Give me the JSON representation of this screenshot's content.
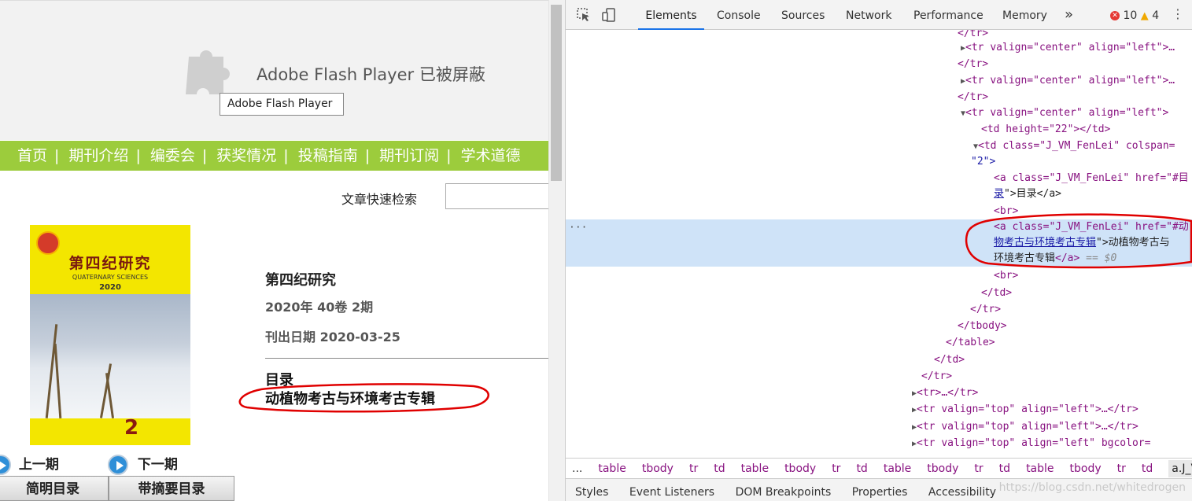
{
  "page": {
    "flash": {
      "message": "Adobe Flash Player 已被屏蔽",
      "tooltip": "Adobe Flash Player"
    },
    "nav": [
      "首页",
      "期刊介绍",
      "编委会",
      "获奖情况",
      "投稿指南",
      "期刊订阅",
      "学术道德"
    ],
    "nav_separator": "|",
    "search_label": "文章快速检索",
    "cover": {
      "title_cn": "第四纪研究",
      "title_en": "QUATERNARY SCIENCES",
      "year": "2020",
      "issue": "2"
    },
    "journal_title": "第四纪研究",
    "volume": "2020年 40卷 2期",
    "pub_date": "刊出日期 2020-03-25",
    "toc_label": "目录",
    "topic_link": "动植物考古与环境考古专辑",
    "prev_issue": "上一期",
    "next_issue": "下一期",
    "tab_simple": "简明目录",
    "tab_abstract": "带摘要目录"
  },
  "devtools": {
    "tabs": [
      "Elements",
      "Console",
      "Sources",
      "Network",
      "Performance",
      "Memory"
    ],
    "more": "»",
    "errors": "10",
    "warnings": "4",
    "tree": {
      "close_tr": "</tr>",
      "tr_open_collapsed": "<tr valign=\"center\" align=\"left\">…",
      "tr_open": "<tr valign=\"center\" align=\"left\">",
      "td_height": "<td height=\"22\"></td>",
      "td_class_open": "<td class=\"J_VM_FenLei\" colspan=",
      "td_class_cont": "\"2\">",
      "a1_open": "<a class=\"J_VM_FenLei\" href=\"#目",
      "a1_href_end": "录",
      "a1_text": "\">目录</a>",
      "br": "<br>",
      "a2_open": "<a class=\"J_VM_FenLei\" href=\"#动",
      "a2_href_end": "物考古与环境考古专辑",
      "a2_text": "\">动植物考古与",
      "a2_text_end": "环境考古专辑",
      "a2_close": "</a>",
      "a2_eq": "== $0",
      "close_td": "</td>",
      "close_tbody": "</tbody>",
      "close_table": "</table>",
      "tr_collapsed": "<tr>…</tr>",
      "tr_top_collapsed": "<tr valign=\"top\" align=\"left\">…</tr>",
      "tr_top_bg": "<tr valign=\"top\" align=\"left\" bgcolor=",
      "dots": "···"
    },
    "breadcrumbs": [
      "...",
      "table",
      "tbody",
      "tr",
      "td",
      "table",
      "tbody",
      "tr",
      "td",
      "table",
      "tbody",
      "tr",
      "td",
      "table",
      "tbody",
      "tr",
      "td",
      "a.J_VM_FenLei"
    ],
    "subtabs": [
      "Styles",
      "Event Listeners",
      "DOM Breakpoints",
      "Properties",
      "Accessibility"
    ],
    "watermark": "https://blog.csdn.net/whitedrogen"
  }
}
